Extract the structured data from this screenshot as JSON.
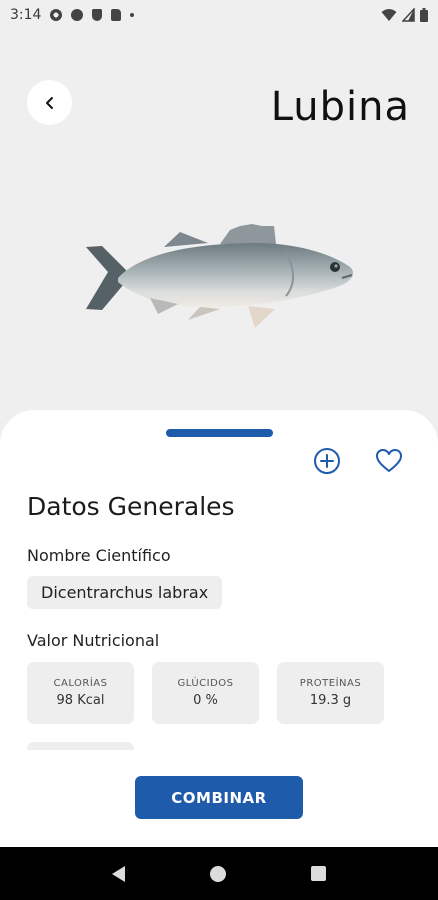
{
  "status_bar": {
    "time": "3:14",
    "icons": [
      "gear-icon",
      "a-icon",
      "shield-icon",
      "sd-card-icon",
      "dot-icon",
      "wifi-icon",
      "signal-icon",
      "battery-icon"
    ]
  },
  "header": {
    "title": "Lubina",
    "back_icon": "chevron-left-icon"
  },
  "image": {
    "subject": "fish"
  },
  "sheet": {
    "section_title": "Datos Generales",
    "scientific_name_label": "Nombre Científico",
    "scientific_name": "Dicentrarchus labrax",
    "nutrition_label": "Valor Nutricional",
    "nutrition": [
      {
        "key": "CALORÍAS",
        "value": "98 Kcal"
      },
      {
        "key": "GLÚCIDOS",
        "value": "0 %"
      },
      {
        "key": "PROTEÍNAS",
        "value": "19.3 g"
      }
    ],
    "combine_label": "COMBINAR",
    "accent_color": "#1f5bab"
  }
}
